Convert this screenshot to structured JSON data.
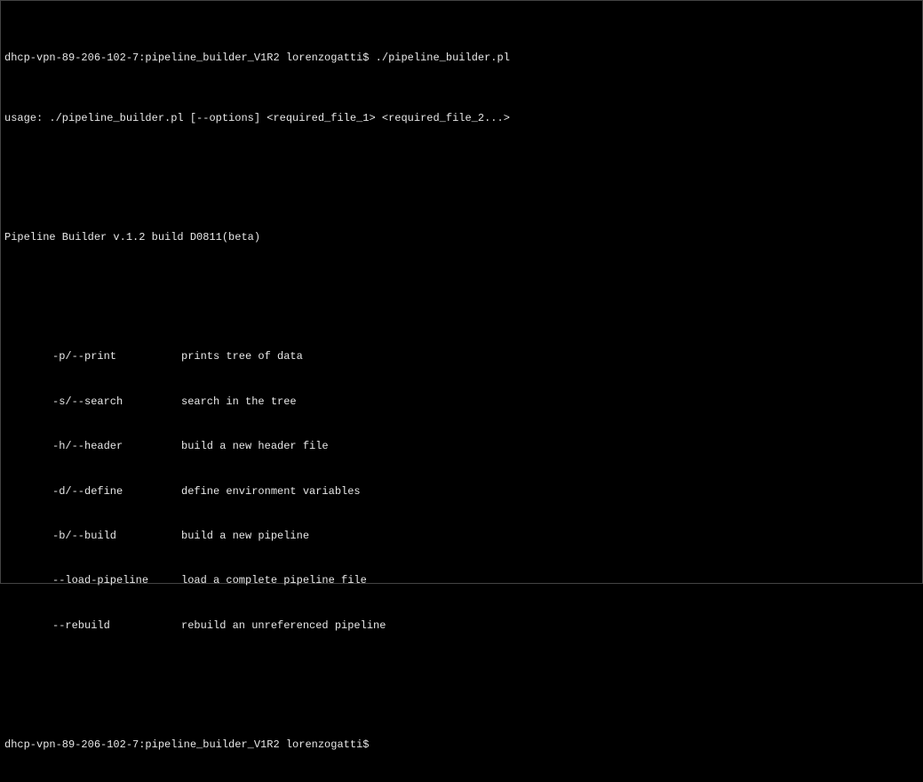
{
  "prompt1": {
    "host_path": "dhcp-vpn-89-206-102-7:pipeline_builder_V1R2 lorenzogatti$ ",
    "command": "./pipeline_builder.pl"
  },
  "usage_line": "usage: ./pipeline_builder.pl [--options] <required_file_1> <required_file_2...>",
  "version_line": "Pipeline Builder v.1.2 build D0811(beta)",
  "options": [
    {
      "flag": "-p/--print",
      "desc": "prints tree of data"
    },
    {
      "flag": "-s/--search",
      "desc": "search in the tree"
    },
    {
      "flag": "-h/--header",
      "desc": "build a new header file"
    },
    {
      "flag": "-d/--define",
      "desc": "define environment variables"
    },
    {
      "flag": "-b/--build",
      "desc": "build a new pipeline"
    },
    {
      "flag": "--load-pipeline",
      "desc": "load a complete pipeline file"
    },
    {
      "flag": "--rebuild",
      "desc": "rebuild an unreferenced pipeline"
    }
  ],
  "prompt2": {
    "host_path": "dhcp-vpn-89-206-102-7:pipeline_builder_V1R2 lorenzogatti$ "
  }
}
